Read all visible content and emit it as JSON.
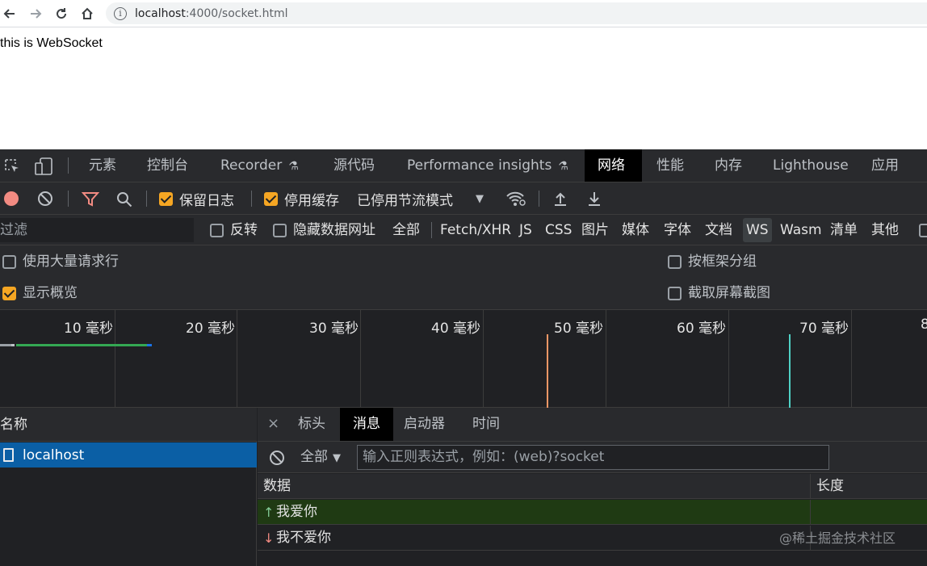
{
  "browser": {
    "url_host": "localhost",
    "url_rest": ":4000/socket.html"
  },
  "page": {
    "text": "this is WebSocket"
  },
  "devtools": {
    "tabs": [
      {
        "label": "元素"
      },
      {
        "label": "控制台"
      },
      {
        "label": "Recorder"
      },
      {
        "label": "源代码"
      },
      {
        "label": "Performance insights"
      },
      {
        "label": "网络",
        "active": true
      },
      {
        "label": "性能"
      },
      {
        "label": "内存"
      },
      {
        "label": "Lighthouse"
      },
      {
        "label": "应用"
      }
    ],
    "toolbar": {
      "preserve_log": "保留日志",
      "disable_cache": "停用缓存",
      "throttle": "已停用节流模式"
    },
    "filter": {
      "label": "过滤",
      "invert": "反转",
      "hide_data_urls": "隐藏数据网址",
      "types": [
        "全部",
        "Fetch/XHR",
        "JS",
        "CSS",
        "图片",
        "媒体",
        "字体",
        "文档",
        "WS",
        "Wasm",
        "清单",
        "其他"
      ],
      "active_type": "WS"
    },
    "options": {
      "large_rows": "使用大量请求行",
      "group_by_frame": "按框架分组",
      "show_overview": "显示概览",
      "capture_screenshots": "截取屏幕截图"
    },
    "overview_ticks": [
      "10 毫秒",
      "20 毫秒",
      "30 毫秒",
      "40 毫秒",
      "50 毫秒",
      "60 毫秒",
      "70 毫秒",
      "8"
    ],
    "requests": {
      "header": "名称",
      "items": [
        {
          "name": "localhost"
        }
      ]
    },
    "detail": {
      "close": "×",
      "tabs": [
        "标头",
        "消息",
        "启动器",
        "时间"
      ],
      "active_tab": "消息",
      "filter_select": "全部",
      "filter_placeholder": "输入正则表达式，例如：(web)?socket",
      "columns": [
        "数据",
        "长度"
      ],
      "messages": [
        {
          "direction": "↑",
          "data": "我爱你",
          "type": "sent"
        },
        {
          "direction": "↓",
          "data": "我不爱你",
          "type": "received"
        }
      ]
    },
    "watermark": "@稀土掘金技术社区"
  },
  "colors": {
    "accent_orange": "#f5a623",
    "sent_row": "#1f3a13",
    "selected_blue": "#0b5fa5",
    "sent_arrow": "#81c995",
    "received_arrow": "#f28b82"
  }
}
